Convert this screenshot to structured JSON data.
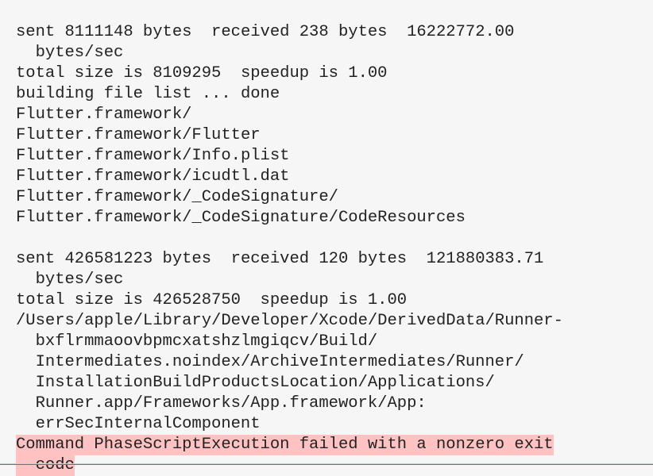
{
  "log": {
    "l0": "sent 8111148 bytes  received 238 bytes  16222772.00",
    "l0c": "bytes/sec",
    "l1": "total size is 8109295  speedup is 1.00",
    "l2": "building file list ... done",
    "l3": "Flutter.framework/",
    "l4": "Flutter.framework/Flutter",
    "l5": "Flutter.framework/Info.plist",
    "l6": "Flutter.framework/icudtl.dat",
    "l7": "Flutter.framework/_CodeSignature/",
    "l8": "Flutter.framework/_CodeSignature/CodeResources",
    "blank": " ",
    "l9": "sent 426581223 bytes  received 120 bytes  121880383.71",
    "l9c": "bytes/sec",
    "l10": "total size is 426528750  speedup is 1.00",
    "l11": "/Users/apple/Library/Developer/Xcode/DerivedData/Runner-",
    "l11c1": "bxflrmmaoovbpmcxatshzlmgiqcv/Build/",
    "l11c2": "Intermediates.noindex/ArchiveIntermediates/Runner/",
    "l11c3": "InstallationBuildProductsLocation/Applications/",
    "l11c4": "Runner.app/Frameworks/App.framework/App:",
    "l11c5": "errSecInternalComponent",
    "err": "Command PhaseScriptExecution failed with a nonzero exit",
    "errc": "code"
  }
}
